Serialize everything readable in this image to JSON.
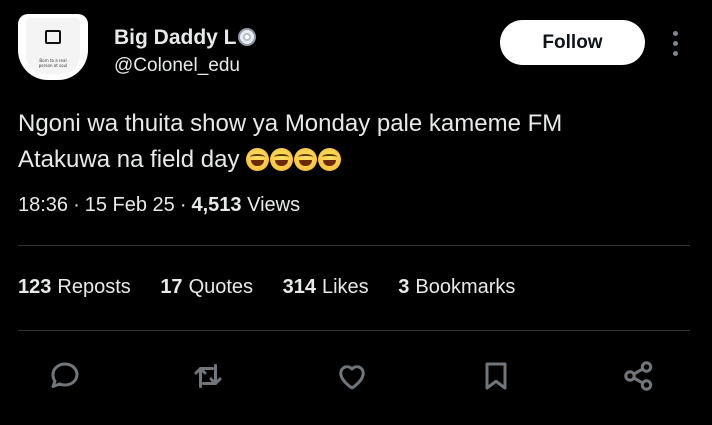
{
  "author": {
    "display_name": "Big Daddy L",
    "badge_icon": "cd-icon",
    "handle": "@Colonel_edu",
    "avatar_text": "Born to a real person ot soul"
  },
  "follow_button": {
    "label": "Follow"
  },
  "more_icon": "more-vertical-icon",
  "tweet": {
    "line1": "Ngoni wa thuita show ya Monday pale kameme FM",
    "line2": "Atakuwa na field day",
    "emojis": [
      "grinning-face-icon",
      "grinning-face-icon",
      "grinning-face-icon",
      "grinning-face-icon"
    ]
  },
  "meta": {
    "time": "18:36",
    "date": "15 Feb 25",
    "views_count": "4,513",
    "views_label": "Views"
  },
  "stats": [
    {
      "count": "123",
      "label": "Reposts"
    },
    {
      "count": "17",
      "label": "Quotes"
    },
    {
      "count": "314",
      "label": "Likes"
    },
    {
      "count": "3",
      "label": "Bookmarks"
    }
  ],
  "actions": [
    "reply-icon",
    "repost-icon",
    "like-icon",
    "bookmark-icon",
    "share-icon"
  ],
  "colors": {
    "background": "#000000",
    "text": "#e7e9ea",
    "icon": "#71767b",
    "divider": "#2f3336",
    "follow_bg": "#ffffff"
  }
}
